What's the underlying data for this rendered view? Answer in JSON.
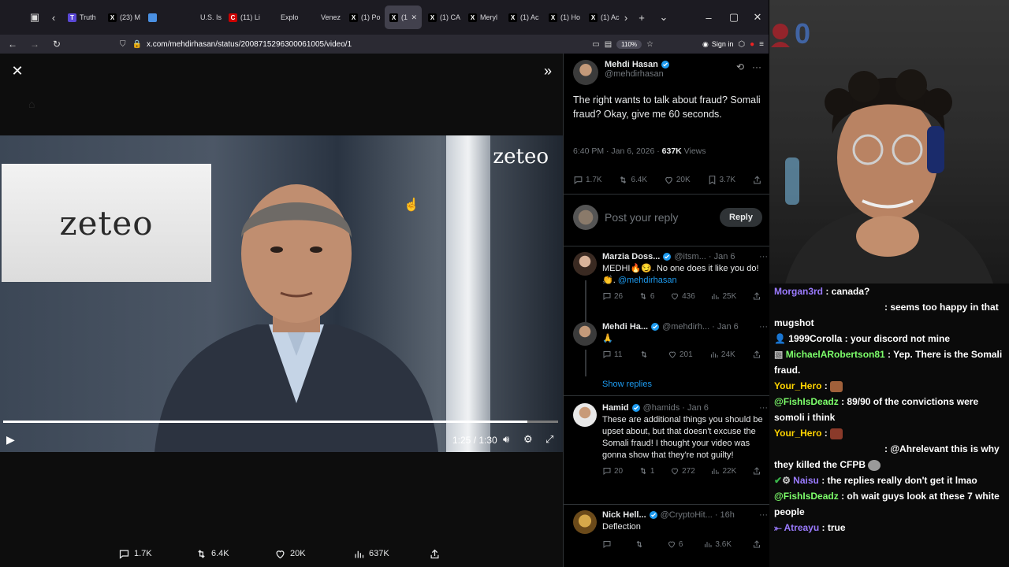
{
  "browser": {
    "tabs": [
      {
        "label": "Truth",
        "fav": "T",
        "color": "#5a48d6"
      },
      {
        "label": "(23) M",
        "fav": "X",
        "color": "#000000"
      },
      {
        "label": "",
        "fav": "",
        "color": "#4a90e2"
      },
      {
        "label": "U.S. Is",
        "fav": "",
        "color": "#1c1b22"
      },
      {
        "label": "(11) Li",
        "fav": "C",
        "color": "#cc0000"
      },
      {
        "label": "Explo",
        "fav": "",
        "color": "#1c1b22"
      },
      {
        "label": "Venez",
        "fav": "",
        "color": "#1c1b22"
      },
      {
        "label": "(1) Po",
        "fav": "X",
        "color": "#000000"
      },
      {
        "label": "(1",
        "fav": "X",
        "color": "#000000",
        "active": true
      },
      {
        "label": "(1) CA",
        "fav": "X",
        "color": "#000000"
      },
      {
        "label": "Meryl",
        "fav": "X",
        "color": "#000000"
      },
      {
        "label": "(1) Ac",
        "fav": "X",
        "color": "#000000"
      },
      {
        "label": "(1) Ho",
        "fav": "X",
        "color": "#000000"
      },
      {
        "label": "(1) Ac",
        "fav": "X",
        "color": "#000000"
      }
    ],
    "url": "x.com/mehdirhasan/status/2008715296300061005/video/1",
    "zoom": "110%",
    "signin": "Sign in"
  },
  "video": {
    "watermark": "zeteo",
    "screen_logo": "zeteo",
    "time": "1:25 / 1:30",
    "progress": 0.944
  },
  "media_stats": {
    "replies": "1.7K",
    "reposts": "6.4K",
    "likes": "20K",
    "views": "637K"
  },
  "tweet": {
    "author_name": "Mehdi Hasan",
    "author_handle": "@mehdirhasan",
    "text": "The right wants to talk about fraud? Somali fraud? Okay, give me 60 seconds.",
    "time": "6:40 PM · Jan 6, 2026 · ",
    "views_count": "637K",
    "views_label": " Views",
    "replies": "1.7K",
    "reposts": "6.4K",
    "likes": "20K",
    "bookmarks": "3.7K",
    "reply_placeholder": "Post your reply",
    "reply_button": "Reply"
  },
  "replies": [
    {
      "name": "Marzia Doss...",
      "handle": "@itsm...",
      "date": "· Jan 6",
      "text": "MEDHI🔥😏. No one does it like you do! 👏. ",
      "mention": "@mehdirhasan",
      "replies": "26",
      "reposts": "6",
      "likes": "436",
      "views": "25K"
    },
    {
      "name": "Mehdi Ha...",
      "handle": "@mehdirh...",
      "date": "· Jan 6",
      "text": "🙏",
      "mention": "",
      "replies": "11",
      "reposts": "",
      "likes": "201",
      "views": "24K"
    },
    {
      "name": "Hamid",
      "handle": "@hamids",
      "date": "· Jan 6",
      "text": "These are additional things you should be upset about, but that doesn't excuse the Somali fraud! I thought your video was gonna show that they're not guilty!",
      "mention": "",
      "replies": "20",
      "reposts": "1",
      "likes": "272",
      "views": "22K"
    },
    {
      "name": "Nick Hell...",
      "handle": "@CryptoHit...",
      "date": "· 16h",
      "text": "Deflection",
      "mention": "",
      "replies": "",
      "reposts": "",
      "likes": "6",
      "views": "3.6K"
    }
  ],
  "show_replies": "Show replies",
  "stream_badge": "0",
  "chat": [
    {
      "user": "Morgan3rd",
      "color": "#9b7bff",
      "text": " : canada?"
    },
    {
      "user": "",
      "color": "#ffffff",
      "text": ": seems too happy in that mugshot"
    },
    {
      "user": "1999Corolla",
      "color": "#ffffff",
      "text": " : your discord not mine"
    },
    {
      "user": "MichaelARobertson81",
      "color": "#7dff6b",
      "text": " : Yep. There is the Somali fraud."
    },
    {
      "user": "Your_Hero",
      "color": "#ffd400",
      "text": " : "
    },
    {
      "user": "@FishIsDeadz",
      "color": "#7dff6b",
      "text": " : 89/90 of the convictions were somoli i think"
    },
    {
      "user": "Your_Hero",
      "color": "#ffd400",
      "text": " : "
    },
    {
      "user": "",
      "color": "#ffffff",
      "text": ": @Ahrelevant this is why they killed the CFPB"
    },
    {
      "user": "Naisu",
      "color": "#9b7bff",
      "text": " : the replies really don't get it lmao"
    },
    {
      "user": "@FishIsDeadz",
      "color": "#7dff6b",
      "text": " : oh wait guys look at these 7 white people"
    },
    {
      "user": "Atreayu",
      "color": "#9b7bff",
      "text": " : true"
    }
  ]
}
